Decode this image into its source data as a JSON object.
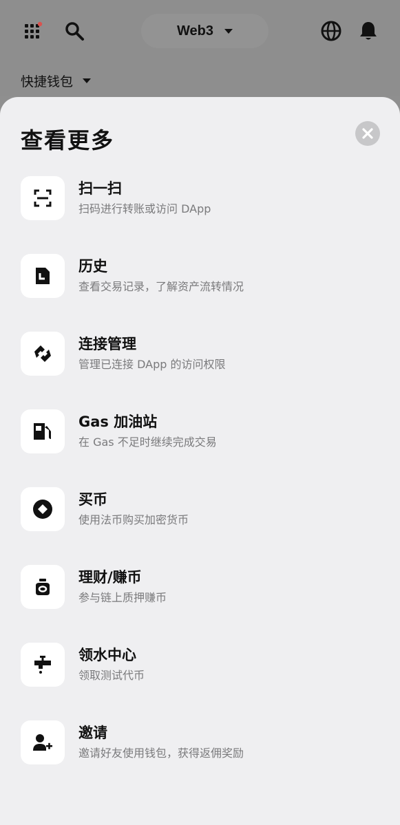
{
  "header": {
    "network_label": "Web3",
    "wallet_selector_label": "快捷钱包"
  },
  "sheet": {
    "title": "查看更多",
    "items": [
      {
        "label": "扫一扫",
        "desc": "扫码进行转账或访问 DApp",
        "icon": "scan-icon"
      },
      {
        "label": "历史",
        "desc": "查看交易记录，了解资产流转情况",
        "icon": "history-icon"
      },
      {
        "label": "连接管理",
        "desc": "管理已连接 DApp 的访问权限",
        "icon": "connection-icon"
      },
      {
        "label": "Gas 加油站",
        "desc": "在 Gas 不足时继续完成交易",
        "icon": "gas-station-icon"
      },
      {
        "label": "买币",
        "desc": "使用法币购买加密货币",
        "icon": "buy-crypto-icon"
      },
      {
        "label": "理财/赚币",
        "desc": "参与链上质押赚币",
        "icon": "earn-icon"
      },
      {
        "label": "领水中心",
        "desc": "领取测试代币",
        "icon": "faucet-icon"
      },
      {
        "label": "邀请",
        "desc": "邀请好友使用钱包，获得返佣奖励",
        "icon": "invite-icon"
      }
    ]
  },
  "colors": {
    "overlay": "#8f8f8f",
    "sheet_bg": "#efeff1",
    "tile_bg": "#ffffff",
    "text_primary": "#111111",
    "text_secondary": "#7a7a7c",
    "notification_dot": "#d9534f"
  }
}
